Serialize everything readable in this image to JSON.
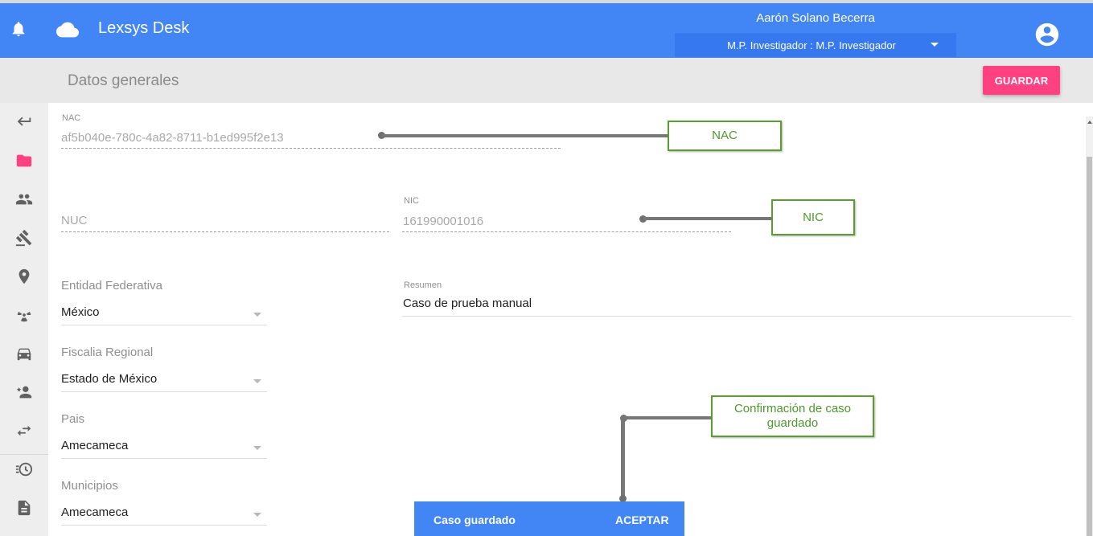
{
  "app": {
    "title": "Lexsys Desk"
  },
  "user": {
    "name": "Aarón Solano Becerra",
    "role": "M.P. Investigador : M.P. Investigador"
  },
  "subheader": {
    "title": "Datos generales",
    "save_label": "GUARDAR"
  },
  "sidebar": {
    "items": [
      {
        "icon": "back-arrow-icon"
      },
      {
        "icon": "folder-icon",
        "active": true
      },
      {
        "icon": "people-icon"
      },
      {
        "icon": "gavel-icon"
      },
      {
        "icon": "location-pin-icon"
      },
      {
        "icon": "radioactive-icon"
      },
      {
        "icon": "car-icon"
      },
      {
        "icon": "person-star-icon"
      },
      {
        "icon": "swap-arrows-icon"
      },
      {
        "icon": "history-icon"
      },
      {
        "icon": "document-icon"
      }
    ]
  },
  "form": {
    "nac": {
      "label": "NAC",
      "value": "af5b040e-780c-4a82-8711-b1ed995f2e13"
    },
    "nuc": {
      "placeholder": "NUC"
    },
    "nic": {
      "label": "NIC",
      "value": "161990001016"
    },
    "entidad": {
      "label": "Entidad Federativa",
      "value": "México"
    },
    "fiscalia": {
      "label": "Fiscalia Regional",
      "value": "Estado de México"
    },
    "pais": {
      "label": "Pais",
      "value": "Amecameca"
    },
    "municipios": {
      "label": "Municipios",
      "value": "Amecameca"
    },
    "resumen": {
      "label": "Resumen",
      "value": "Caso de prueba manual"
    }
  },
  "callouts": {
    "nac": "NAC",
    "nic": "NIC",
    "confirm": "Confirmación de caso guardado"
  },
  "snackbar": {
    "message": "Caso guardado",
    "action": "ACEPTAR"
  },
  "colors": {
    "primary": "#4285f4",
    "accent": "#ff4081",
    "callout_border": "#5a9e2f",
    "callout_text": "#4b9a2a"
  }
}
